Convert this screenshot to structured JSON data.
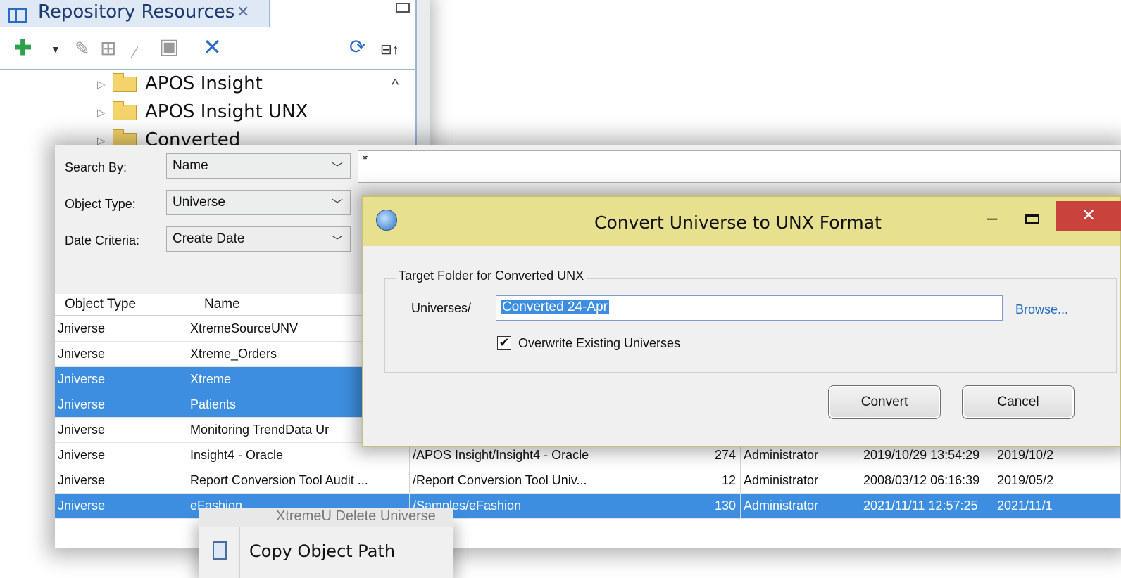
{
  "repository": {
    "tab_title": "Repository Resources",
    "tab_close": "✕",
    "toolbar": {
      "add": "✚",
      "dropdown": "▼",
      "edit": "✎",
      "universe": "⊞",
      "wand": "⁄",
      "properties": "▣",
      "delete": "✕",
      "refresh": "⟳",
      "collapse": "⊟↑"
    },
    "scroll_up": "^",
    "tree": [
      {
        "label": "APOS Insight"
      },
      {
        "label": "APOS Insight UNX"
      },
      {
        "label": "Converted"
      }
    ]
  },
  "search": {
    "fields": [
      {
        "label": "Search By:",
        "value": "Name"
      },
      {
        "label": "Object Type:",
        "value": "Universe"
      },
      {
        "label": "Date Criteria:",
        "value": "Create Date"
      }
    ],
    "query": "*",
    "columns": [
      "Object Type",
      "Name"
    ],
    "rows": [
      {
        "type": "Jniverse",
        "name": "XtremeSourceUNV",
        "path": "",
        "count": "",
        "owner": "",
        "created": "",
        "modified": "",
        "selected": false
      },
      {
        "type": "Jniverse",
        "name": "Xtreme_Orders",
        "path": "",
        "count": "",
        "owner": "",
        "created": "",
        "modified": "",
        "selected": false
      },
      {
        "type": "Jniverse",
        "name": "Xtreme",
        "path": "",
        "count": "",
        "owner": "",
        "created": "",
        "modified": "",
        "selected": true
      },
      {
        "type": "Jniverse",
        "name": "Patients",
        "path": "",
        "count": "",
        "owner": "",
        "created": "",
        "modified": "",
        "selected": true
      },
      {
        "type": "Jniverse",
        "name": "Monitoring TrendData Ur",
        "path": "",
        "count": "",
        "owner": "",
        "created": "",
        "modified": "",
        "selected": false
      },
      {
        "type": "Jniverse",
        "name": "Insight4 - Oracle",
        "path": "/APOS Insight/Insight4 - Oracle",
        "count": "274",
        "owner": "Administrator",
        "created": "2019/10/29 13:54:29",
        "modified": "2019/10/2",
        "selected": false
      },
      {
        "type": "Jniverse",
        "name": "Report Conversion Tool Audit ...",
        "path": "/Report Conversion Tool Univ...",
        "count": "12",
        "owner": "Administrator",
        "created": "2008/03/12 06:16:39",
        "modified": "2019/05/2",
        "selected": false
      },
      {
        "type": "Jniverse",
        "name": "eFashion",
        "path": "/Samples/eFashion",
        "count": "130",
        "owner": "Administrator",
        "created": "2021/11/11 12:57:25",
        "modified": "2021/11/1",
        "selected": true
      }
    ]
  },
  "context_menu": {
    "partial_item": "XtremeU  Delete Universe",
    "copy_path": "Copy Object Path"
  },
  "dialog": {
    "title": "Convert Universe to UNX Format",
    "minimize": "–",
    "close": "✕",
    "group_label": "Target Folder for Converted UNX",
    "prefix": "Universes/",
    "target_value": "Converted 24-Apr",
    "browse": "Browse...",
    "overwrite_label": "Overwrite Existing Universes",
    "overwrite_checked": "✔",
    "convert": "Convert",
    "cancel": "Cancel"
  }
}
